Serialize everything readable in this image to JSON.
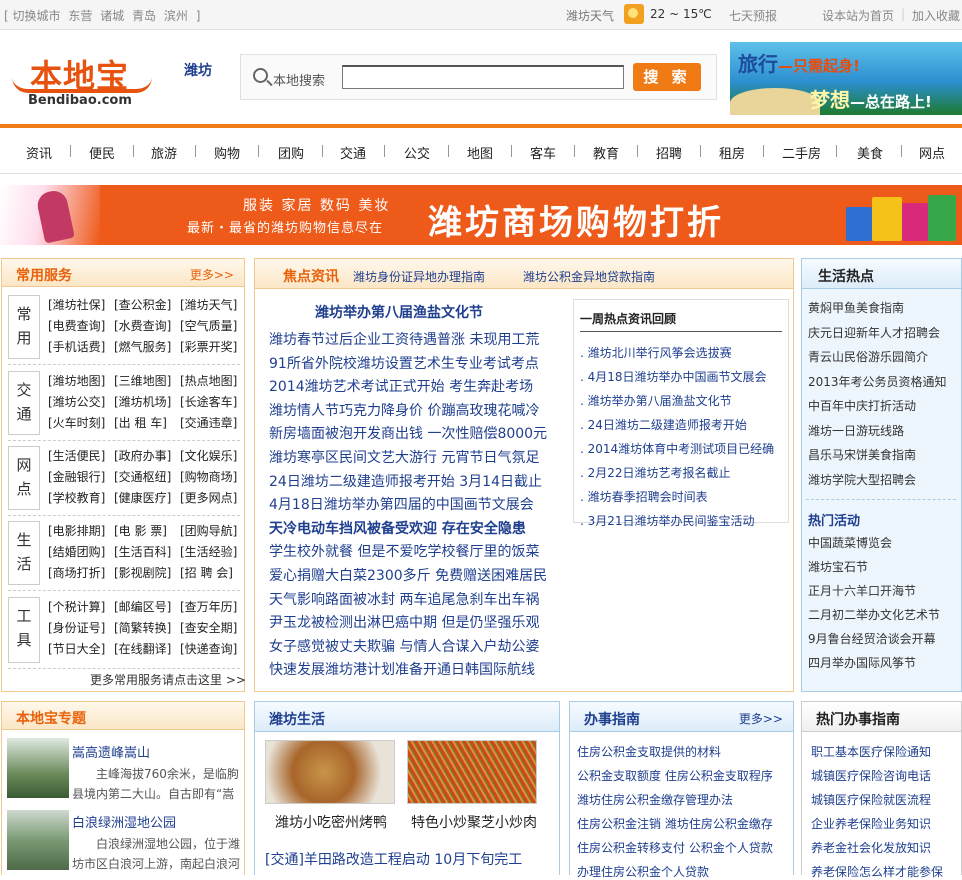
{
  "topbar": {
    "switch_city": "[ 切换城市",
    "cities": [
      "东营",
      "诸城",
      "青岛",
      "滨州"
    ],
    "cities_end": "]",
    "weather_label": "潍坊天气",
    "temperature": "22 ~ 15℃",
    "forecast": "七天预报",
    "set_home": "设本站为首页",
    "divider": "|",
    "add_favorite": "加入收藏"
  },
  "header": {
    "logo_cn": "本地宝",
    "logo_en": "Bendibao.com",
    "city": "潍坊",
    "search_label": "本地搜索",
    "search_value": "",
    "search_button": "搜 索",
    "travel_line1": "旅行",
    "travel_line1_tail": "—只需起身!",
    "travel_line2": "梦想",
    "travel_line2_tail": "—总在路上!"
  },
  "nav": {
    "items": [
      "资讯",
      "便民",
      "旅游",
      "购物",
      "团购",
      "交通",
      "公交",
      "地图",
      "客车",
      "教育",
      "招聘",
      "租房",
      "二手房",
      "美食",
      "网点"
    ]
  },
  "promo": {
    "line1": "服装 家居 数码 美妆",
    "line2": "最新・最省的潍坊购物信息尽在",
    "title": "潍坊商场购物打折"
  },
  "services": {
    "title": "常用服务",
    "more": "更多>>",
    "footer": "更多常用服务请点击这里 >>",
    "groups": [
      {
        "tag": "常用",
        "links": [
          "[潍坊社保]",
          "[查公积金]",
          "[潍坊天气]",
          "[电费查询]",
          "[水费查询]",
          "[空气质量]",
          "[手机话费]",
          "[燃气服务]",
          "[彩票开奖]"
        ]
      },
      {
        "tag": "交通",
        "links": [
          "[潍坊地图]",
          "[三维地图]",
          "[热点地图]",
          "[潍坊公交]",
          "[潍坊机场]",
          "[长途客车]",
          "[火车时刻]",
          "[出 租 车]",
          "[交通违章]"
        ]
      },
      {
        "tag": "网点",
        "links": [
          "[生活便民]",
          "[政府办事]",
          "[文化娱乐]",
          "[金融银行]",
          "[交通枢纽]",
          "[购物商场]",
          "[学校教育]",
          "[健康医疗]",
          "[更多网点]"
        ]
      },
      {
        "tag": "生活",
        "links": [
          "[电影排期]",
          "[电 影 票]",
          "[团购导航]",
          "[结婚团购]",
          "[生活百科]",
          "[生活经验]",
          "[商场打折]",
          "[影视剧院]",
          "[招 聘 会]"
        ]
      },
      {
        "tag": "工具",
        "links": [
          "[个税计算]",
          "[邮编区号]",
          "[查万年历]",
          "[身份证号]",
          "[简繁转换]",
          "[查安全期]",
          "[节日大全]",
          "[在线翻译]",
          "[快递查询]"
        ]
      }
    ]
  },
  "news": {
    "title": "焦点资讯",
    "header_links": [
      "潍坊身份证异地办理指南",
      "潍坊公积金异地贷款指南"
    ],
    "headline": "潍坊举办第八届渔盐文化节",
    "lines": [
      {
        "text": "潍坊春节过后企业工资待遇普涨 未现用工荒",
        "bold": false
      },
      {
        "text": "91所省外院校潍坊设置艺术生专业考试考点",
        "bold": false
      },
      {
        "text": "2014潍坊艺术考试正式开始 考生奔赴考场",
        "bold": false
      },
      {
        "text": "潍坊情人节巧克力降身价 价蹦高玫瑰花喊冷",
        "bold": false
      },
      {
        "text": "新房墙面被泡开发商出钱 一次性赔偿8000元",
        "bold": false
      },
      {
        "text": "潍坊寒亭区民间文艺大游行 元宵节日气氛足",
        "bold": false
      },
      {
        "text": "24日潍坊二级建造师报考开始 3月14日截止",
        "bold": false
      },
      {
        "text": "4月18日潍坊举办第四届的中国画节文展会",
        "bold": false
      },
      {
        "text": "天冷电动车挡风被备受欢迎 存在安全隐患",
        "bold": true
      },
      {
        "text": "学生校外就餐 但是不爱吃学校餐厅里的饭菜",
        "bold": false
      },
      {
        "text": "爱心捐赠大白菜2300多斤 免费赠送困难居民",
        "bold": false
      },
      {
        "text": "天气影响路面被冰封 两车追尾急刹车出车祸",
        "bold": false
      },
      {
        "text": "尹玉龙被检测出淋巴癌中期 但是仍坚强乐观",
        "bold": false
      },
      {
        "text": "女子感觉被丈夫欺骗 与情人合谋入户劫公婆",
        "bold": false
      },
      {
        "text": "快速发展潍坊港计划准备开通日韩国际航线",
        "bold": false
      }
    ],
    "recap_title": "一周热点资讯回顾",
    "recap": [
      ". 潍坊北川举行风筝会选拔赛",
      ". 4月18日潍坊举办中国画节文展会",
      ". 潍坊举办第八届渔盐文化节",
      ". 24日潍坊二级建造师报考开始",
      ". 2014潍坊体育中考测试项目已经确",
      ". 2月22日潍坊艺考报名截止",
      ". 潍坊春季招聘会时间表",
      ". 3月21日潍坊举办民间鉴宝活动"
    ]
  },
  "life_hot": {
    "title": "生活热点",
    "items": [
      "黄焖甲鱼美食指南",
      "庆元日迎新年人才招聘会",
      "青云山民俗游乐园简介",
      "2013年考公务员资格通知",
      "中百年中庆打折活动",
      "潍坊一日游玩线路",
      "昌乐马宋饼美食指南",
      "潍坊学院大型招聘会"
    ],
    "sub_title": "热门活动",
    "activities": [
      "中国蔬菜博览会",
      "潍坊宝石节",
      "正月十六羊口开海节",
      "二月初二举办文化艺术节",
      "9月鲁台经贸洽谈会开幕",
      "四月举办国际风筝节"
    ]
  },
  "topics": {
    "title": "本地宝专题",
    "items": [
      {
        "title": "嵩高遗峰嵩山",
        "desc": "主峰海拔760余米，是临朐县境内第二大山。自古即有“嵩"
      },
      {
        "title": "白浪绿洲湿地公园",
        "desc": "白浪绿洲湿地公园，位于潍坊市区白浪河上游，南起白浪河"
      }
    ]
  },
  "weifang_life": {
    "title": "潍坊生活",
    "captions": [
      "潍坊小吃密州烤鸭",
      "特色小炒聚芝小炒肉"
    ],
    "link": "[交通]羊田路改造工程启动 10月下旬完工"
  },
  "guide": {
    "title": "办事指南",
    "more": "更多>>",
    "items": [
      "住房公积金支取提供的材料",
      "公积金支取额度 住房公积金支取程序",
      "潍坊住房公积金缴存管理办法",
      "住房公积金注销 潍坊住房公积金缴存",
      "住房公积金转移支付 公积金个人贷款",
      "办理住房公积金个人贷款"
    ]
  },
  "hot_guide": {
    "title": "热门办事指南",
    "items": [
      "职工基本医疗保险通知",
      "城镇医疗保险咨询电话",
      "城镇医疗保险就医流程",
      "企业养老保险业务知识",
      "养老金社会化发放知识",
      "养老保险怎么样才能参保"
    ]
  }
}
